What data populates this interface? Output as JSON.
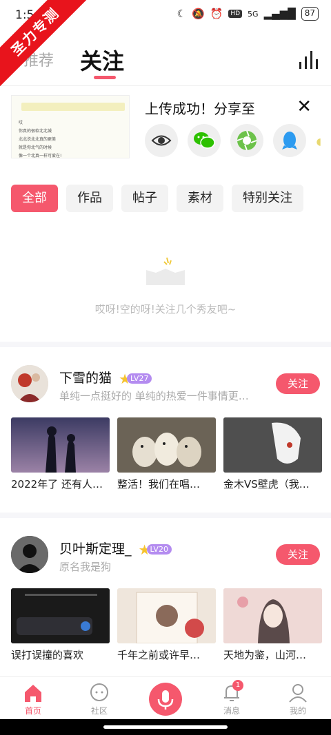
{
  "status_bar": {
    "time": "1:54",
    "battery": "87",
    "hd": "HD",
    "network": "5G"
  },
  "watermark": {
    "text": "圣力专测"
  },
  "header": {
    "tab_recommend": "推荐",
    "tab_follow": "关注"
  },
  "share": {
    "title": "上传成功！分享至",
    "thumb_lines": [
      "哎",
      "你真的很软北北城",
      "北北说北北真的更美",
      "就是你北气的时候",
      "像一个北真一样可爱在!"
    ],
    "icons": [
      "eye-icon",
      "wechat-icon",
      "moments-icon",
      "qq-icon"
    ]
  },
  "chips": [
    "全部",
    "作品",
    "帖子",
    "素材",
    "特别关注"
  ],
  "empty": {
    "text": "哎呀!空的呀!关注几个秀友吧~"
  },
  "creators": [
    {
      "name": "下雪的猫",
      "level": "LV27",
      "bio": "单纯一点挺好的 单纯的热爱一件事情更…",
      "follow_label": "关注",
      "works": [
        {
          "title": "2022年了 还有人…",
          "color": "#5c5a86"
        },
        {
          "title": "整活！我们在唱…",
          "color": "#6b6356"
        },
        {
          "title": "金木VS壁虎（我…",
          "color": "#4a4a4a"
        }
      ]
    },
    {
      "name": "贝叶斯定理_",
      "level": "LV20",
      "bio": "原名我是狗",
      "follow_label": "关注",
      "works": [
        {
          "title": "误打误撞的喜欢",
          "color": "#1d1d1d"
        },
        {
          "title": "千年之前或许早…",
          "color": "#efe6dc"
        },
        {
          "title": "天地为鉴，山河…",
          "color": "#e9c9c9"
        }
      ]
    }
  ],
  "nav": {
    "home": "首页",
    "community": "社区",
    "messages": "消息",
    "messages_badge": "1",
    "me": "我的"
  },
  "colors": {
    "accent": "#f5586d",
    "ribbon": "#e8141c",
    "level_badge": "#b48cf0"
  }
}
